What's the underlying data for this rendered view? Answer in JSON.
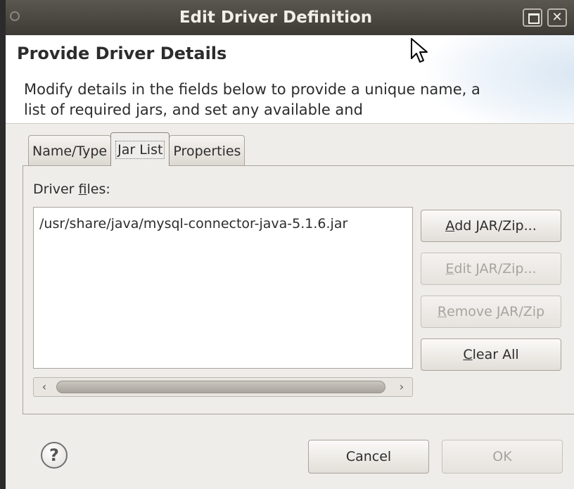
{
  "window": {
    "title": "Edit Driver Definition",
    "close_glyph": "✕"
  },
  "header": {
    "title": "Provide Driver Details",
    "description": "Modify details in the fields below to provide a unique name, a list of required jars, and set any available and"
  },
  "tabs": [
    {
      "label": "Name/Type",
      "active": false
    },
    {
      "label": "Jar List",
      "active": true
    },
    {
      "label": "Properties",
      "active": false
    }
  ],
  "jar_list": {
    "files_label_prefix": "Driver ",
    "files_label_mnemonic": "f",
    "files_label_suffix": "iles:",
    "items": [
      "/usr/share/java/mysql-connector-java-5.1.6.jar"
    ],
    "scroll_left": "‹",
    "scroll_right": "›"
  },
  "buttons": {
    "add": {
      "mnemonic": "A",
      "rest": "dd JAR/Zip...",
      "enabled": true
    },
    "edit": {
      "mnemonic": "E",
      "rest": "dit JAR/Zip...",
      "enabled": false
    },
    "remove": {
      "mnemonic": "R",
      "rest": "emove JAR/Zip",
      "enabled": false
    },
    "clear": {
      "mnemonic": "C",
      "rest": "lear All",
      "enabled": true
    }
  },
  "footer": {
    "help_glyph": "?",
    "cancel_label": "Cancel",
    "ok_label": "OK"
  },
  "icons": {
    "help": "help-icon",
    "maximize": "maximize-icon",
    "close": "close-icon",
    "cursor": "mouse-cursor-icon"
  }
}
